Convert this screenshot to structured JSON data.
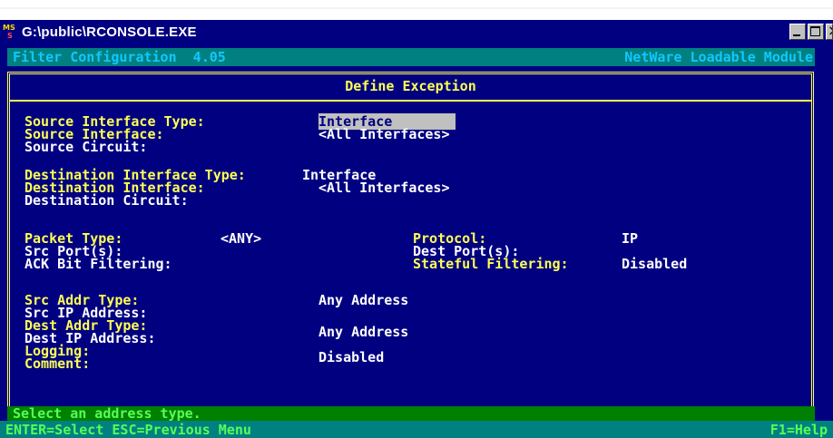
{
  "window": {
    "title": "G:\\public\\RCONSOLE.EXE",
    "icon": "ms-dos-icon",
    "icon_text_top": "MS",
    "icon_text_bottom": "S"
  },
  "header": {
    "left": "Filter Configuration  4.05",
    "right": "NetWare Loadable Module"
  },
  "dialog": {
    "title": "Define Exception",
    "source_interface_type_label": "Source Interface Type:",
    "source_interface_type_value": "Interface",
    "source_interface_label": "Source Interface:",
    "source_interface_value": "<All Interfaces>",
    "source_circuit_label": "Source Circuit:",
    "dest_interface_type_label": "Destination Interface Type:",
    "dest_interface_type_value": "Interface",
    "dest_interface_label": "Destination Interface:",
    "dest_interface_value": "<All Interfaces>",
    "dest_circuit_label": "Destination Circuit:",
    "packet_type_label": "Packet Type:",
    "packet_type_value": "<ANY>",
    "protocol_label": "Protocol:",
    "protocol_value": "IP",
    "src_ports_label": "Src Port(s):",
    "dest_ports_label": "Dest Port(s):",
    "ack_bit_label": "ACK Bit Filtering:",
    "stateful_label": "Stateful Filtering:",
    "stateful_value": "Disabled",
    "src_addr_type_label": "Src Addr Type:",
    "src_addr_type_value": "Any Address",
    "src_ip_label": "Src IP Address:",
    "dest_addr_type_label": "Dest Addr Type:",
    "dest_addr_type_value": "Any Address",
    "dest_ip_label": "Dest IP Address:",
    "logging_label": "Logging:",
    "logging_value": "Disabled",
    "comment_label": "Comment:"
  },
  "status": {
    "message": "Select an address type.",
    "keys_left": "ENTER=Select ESC=Previous Menu",
    "keys_right": "F1=Help"
  },
  "colors": {
    "console_bg": "#000080",
    "label_yellow": "#ffff55",
    "value_white": "#ffffff",
    "header_bg": "#008080",
    "status_green": "#55ff55"
  }
}
